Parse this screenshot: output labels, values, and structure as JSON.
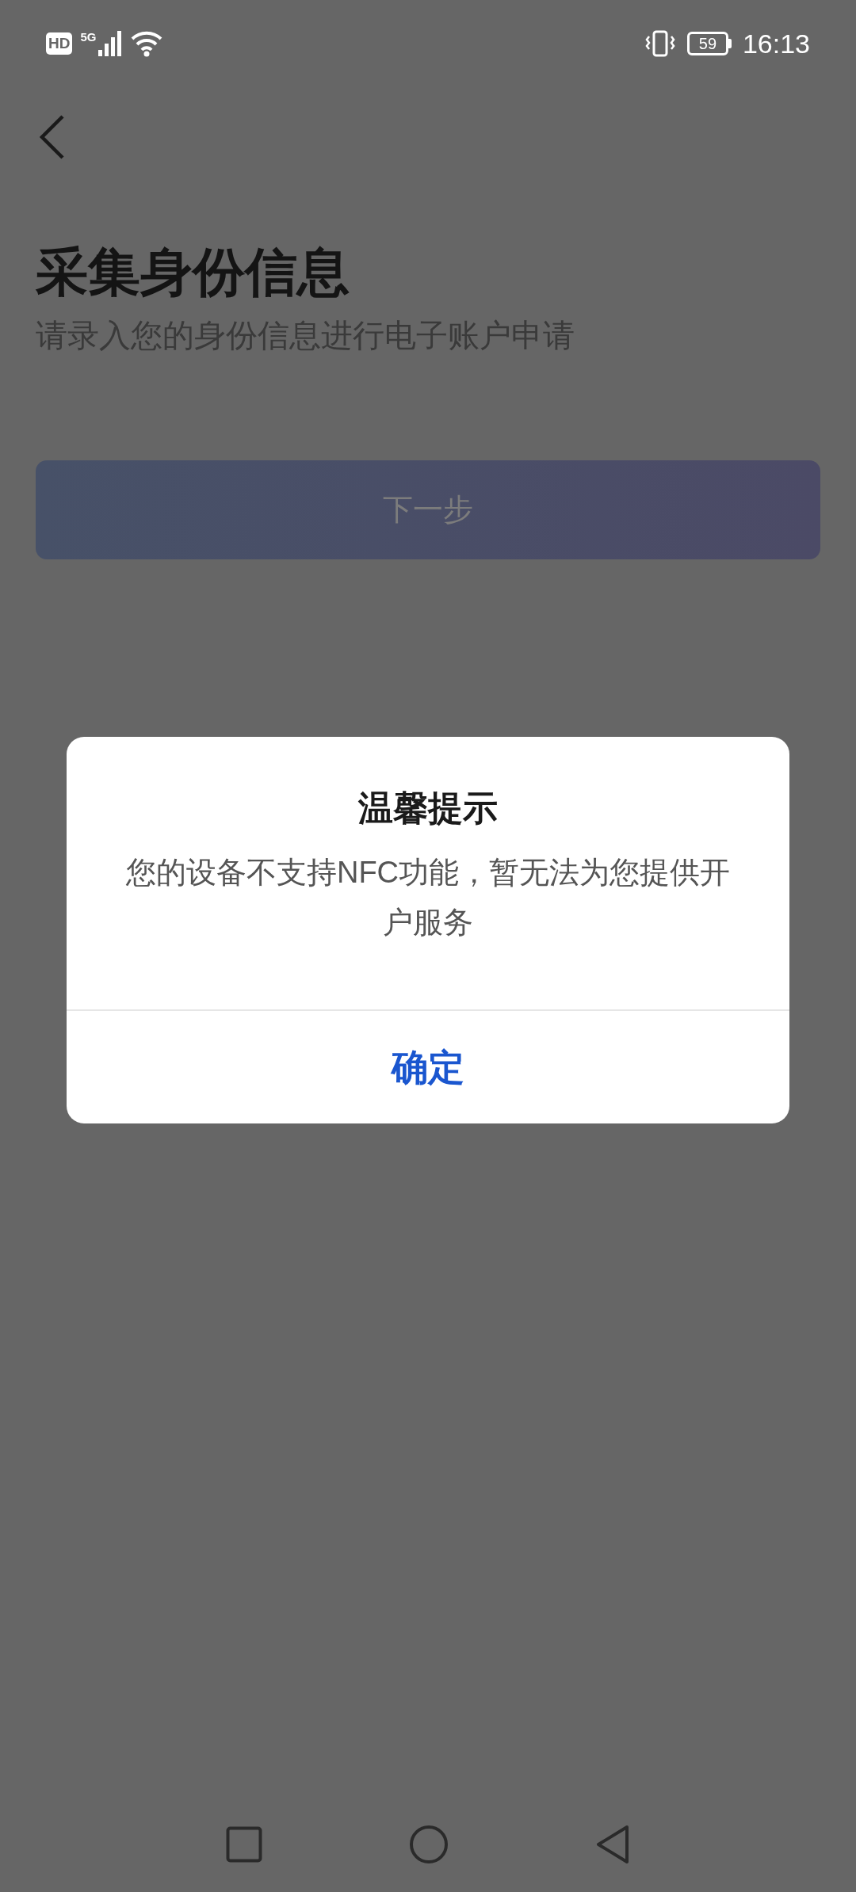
{
  "status_bar": {
    "hd": "HD",
    "network": "5G",
    "battery": "59",
    "time": "16:13"
  },
  "page": {
    "title": "采集身份信息",
    "subtitle": "请录入您的身份信息进行电子账户申请",
    "next_button": "下一步"
  },
  "dialog": {
    "title": "温馨提示",
    "message": "您的设备不支持NFC功能，暂无法为您提供开户服务",
    "confirm": "确定"
  }
}
